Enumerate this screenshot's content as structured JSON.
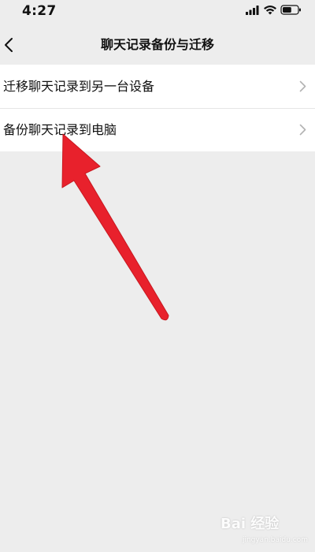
{
  "status_bar": {
    "time": "4:27",
    "signal_icon": "signal-bars-icon",
    "wifi_icon": "wifi-icon",
    "battery_icon": "battery-icon",
    "battery_level": 0.6
  },
  "nav": {
    "back_icon": "chevron-left-icon",
    "title": "聊天记录备份与迁移"
  },
  "list": {
    "items": [
      {
        "label": "迁移聊天记录到另一台设备",
        "icon": "chevron-right-icon"
      },
      {
        "label": "备份聊天记录到电脑",
        "icon": "chevron-right-icon"
      }
    ]
  },
  "overlay": {
    "arrow_icon": "red-annotation-arrow-icon",
    "arrow_color": "#e8212c"
  },
  "watermark": {
    "logo_text": "Bai 经验",
    "url": "jingyan.baidu.com"
  },
  "colors": {
    "background": "#ededed",
    "list_background": "#ffffff",
    "separator": "#e5e5e5",
    "chevron": "#b2b2b2"
  }
}
